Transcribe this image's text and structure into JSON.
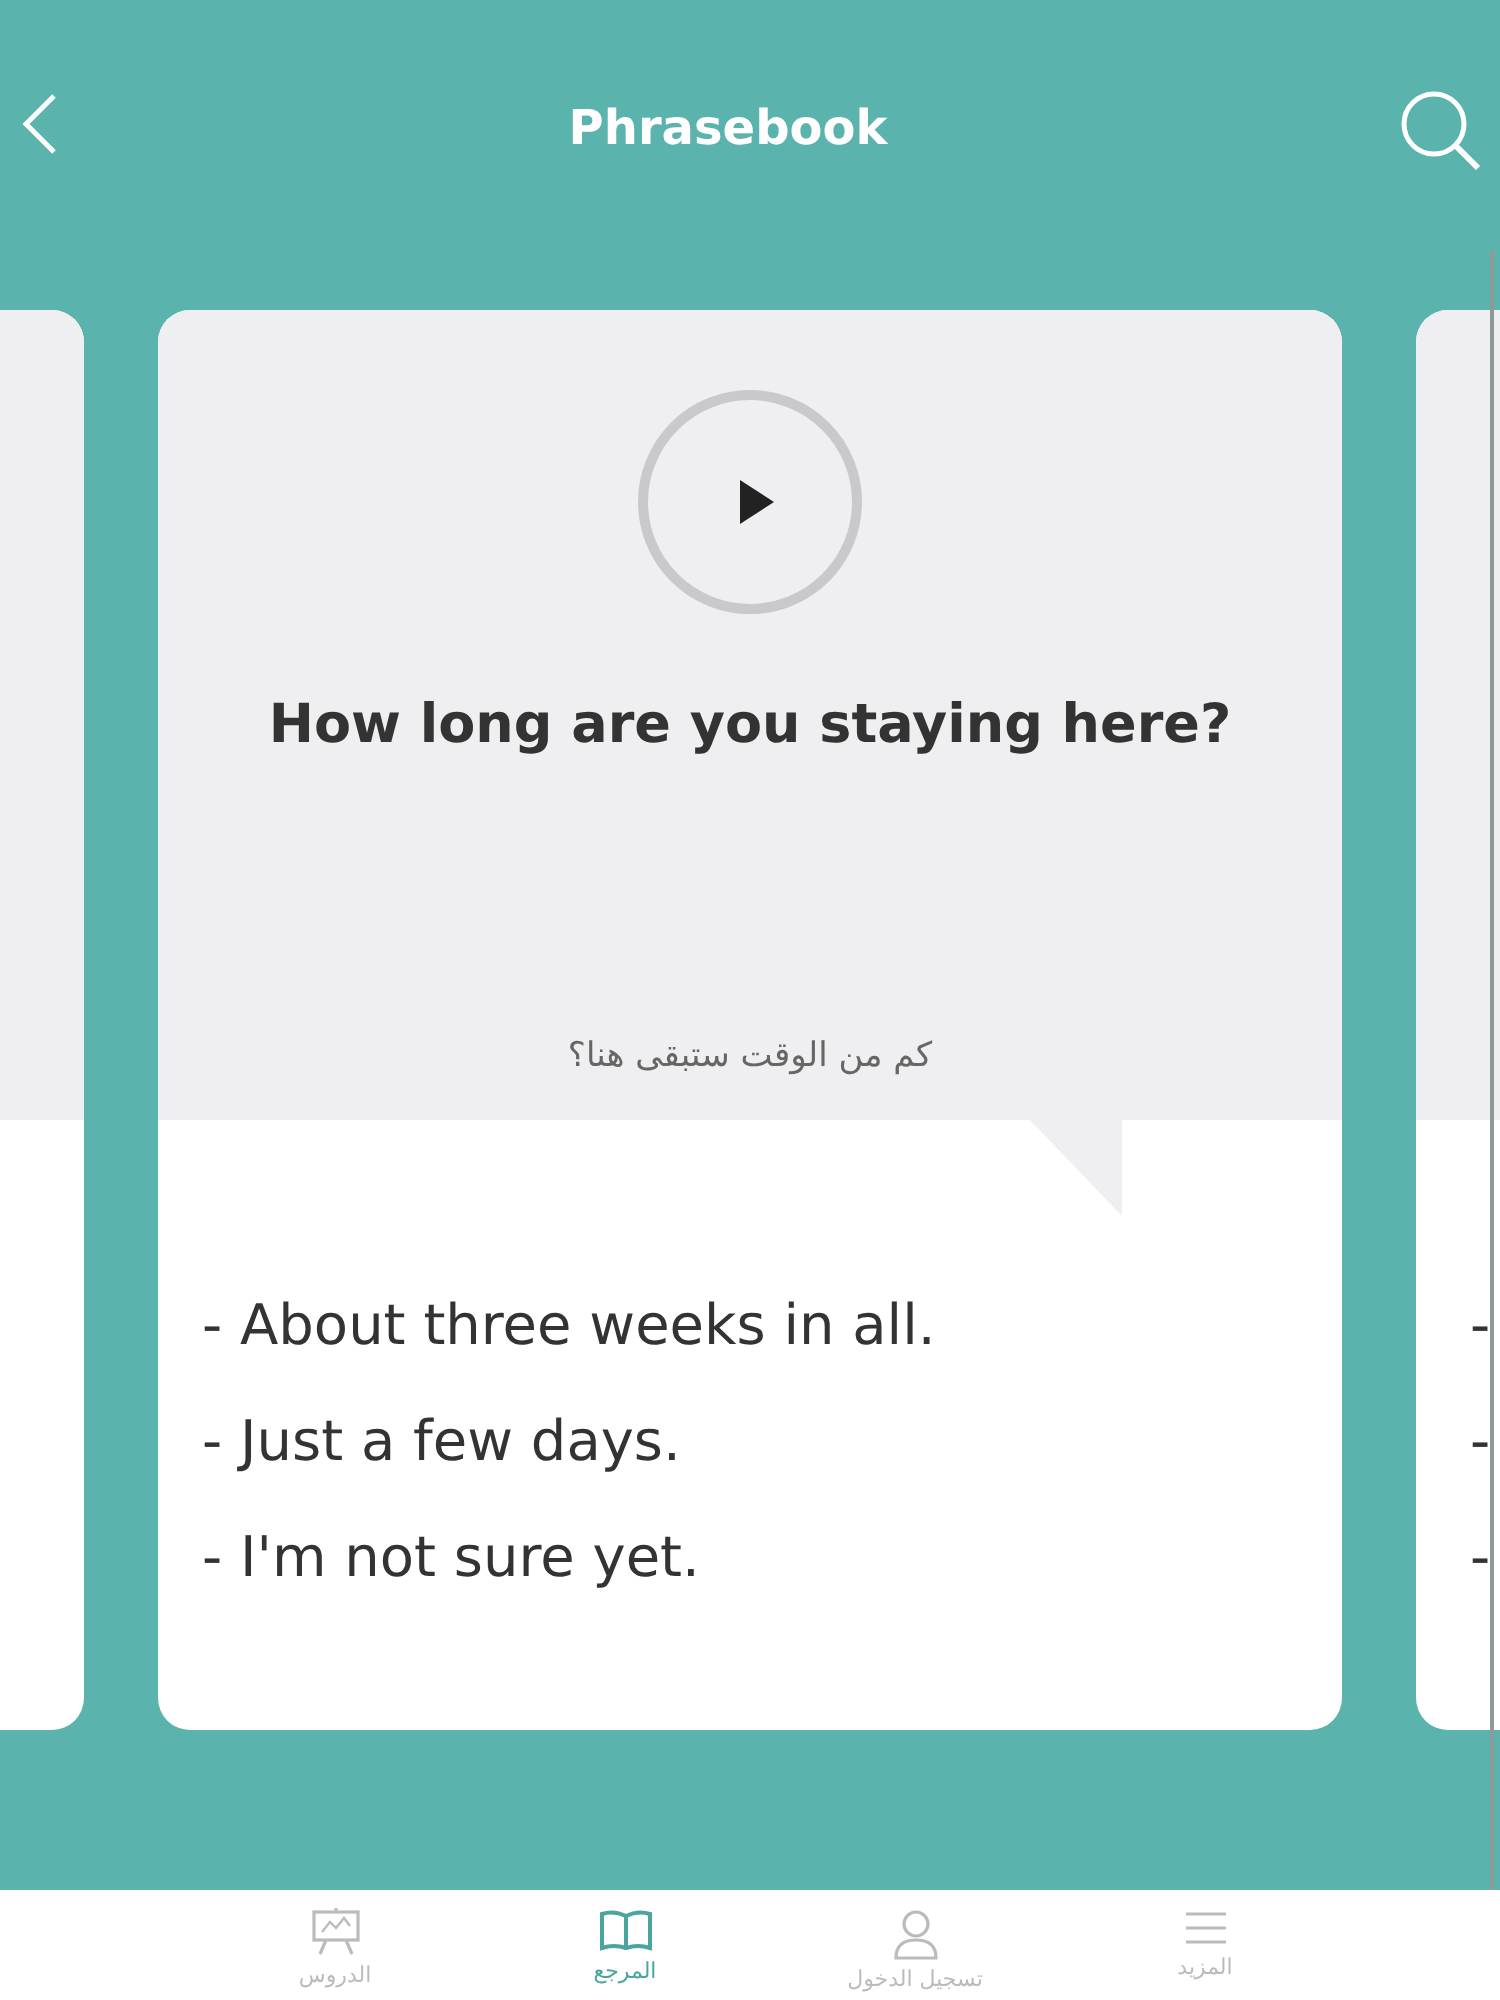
{
  "header": {
    "title": "Phrasebook"
  },
  "card": {
    "phrase": "How long are you staying here?",
    "translation": "كم من الوقت ستبقى هنا؟",
    "answers": [
      "- About three weeks in all.",
      "- Just a few days.",
      "- I'm not sure yet."
    ]
  },
  "next_card": {
    "answers": [
      "-",
      "-",
      "-"
    ]
  },
  "tabs": [
    {
      "label": "المزيد",
      "kind": "menu",
      "selected": false
    },
    {
      "label": "تسجيل الدخول",
      "kind": "person",
      "selected": false
    },
    {
      "label": "المرجع",
      "kind": "book",
      "selected": true
    },
    {
      "label": "الدروس",
      "kind": "easel",
      "selected": false
    }
  ]
}
